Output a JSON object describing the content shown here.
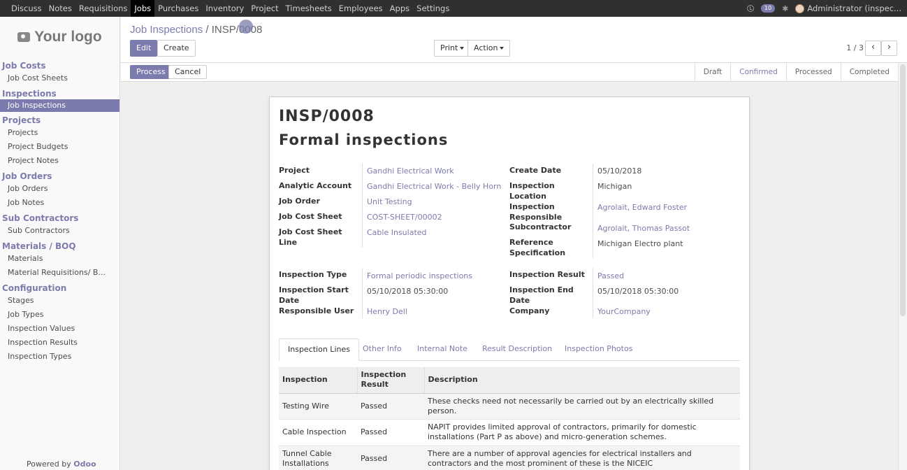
{
  "topmenu": [
    "Discuss",
    "Notes",
    "Requisitions",
    "Jobs",
    "Purchases",
    "Inventory",
    "Project",
    "Timesheets",
    "Employees",
    "Apps",
    "Settings"
  ],
  "topmenu_active": "Jobs",
  "user": {
    "messages_count": "10",
    "name": "Administrator (inspec..."
  },
  "logo": {
    "text": "Your logo"
  },
  "sidebar": {
    "sections": [
      {
        "title": "Job Costs",
        "items": [
          "Job Cost Sheets"
        ]
      },
      {
        "title": "Inspections",
        "items": [
          "Job Inspections"
        ]
      },
      {
        "title": "Projects",
        "items": [
          "Projects",
          "Project Budgets",
          "Project Notes"
        ]
      },
      {
        "title": "Job Orders",
        "items": [
          "Job Orders",
          "Job Notes"
        ]
      },
      {
        "title": "Sub Contractors",
        "items": [
          "Sub Contractors"
        ]
      },
      {
        "title": "Materials / BOQ",
        "items": [
          "Materials",
          "Material Requisitions/ B..."
        ]
      },
      {
        "title": "Configuration",
        "items": [
          "Stages",
          "Job Types",
          "Inspection Values",
          "Inspection Results",
          "Inspection Types"
        ]
      }
    ],
    "active_item": "Job Inspections",
    "powered_by": "Powered by",
    "powered_brand": "Odoo"
  },
  "breadcrumb": {
    "parent": "Job Inspections",
    "separator": "/",
    "current": "INSP/0008"
  },
  "buttons": {
    "edit": "Edit",
    "create": "Create",
    "print": "Print",
    "action": "Action",
    "process": "Process",
    "cancel": "Cancel"
  },
  "pager": {
    "text": "1 / 3"
  },
  "stages": [
    "Draft",
    "Confirmed",
    "Processed",
    "Completed"
  ],
  "active_stage": "Confirmed",
  "record": {
    "name": "INSP/0008",
    "title": "Formal inspections",
    "fields_left": [
      {
        "label": "Project",
        "value": "Gandhi Electrical Work",
        "link": true
      },
      {
        "label": "Analytic Account",
        "value": "Gandhi Electrical Work - Belly Horn",
        "link": true
      },
      {
        "label": "Job Order",
        "value": "Unit Testing",
        "link": true
      },
      {
        "label": "Job Cost Sheet",
        "value": "COST-SHEET/00002",
        "link": true
      },
      {
        "label": "Job Cost Sheet Line",
        "value": "Cable Insulated",
        "link": true
      }
    ],
    "fields_right": [
      {
        "label": "Create Date",
        "value": "05/10/2018",
        "link": false
      },
      {
        "label": "Inspection Location",
        "value": "Michigan",
        "link": false
      },
      {
        "label": "Inspection Responsible",
        "value": "Agrolait, Edward Foster",
        "link": true
      },
      {
        "label": "Subcontractor",
        "value": "Agrolait, Thomas Passot",
        "link": true
      },
      {
        "label": "Reference Specification",
        "value": "Michigan Electro plant",
        "link": false
      }
    ],
    "fields_left2": [
      {
        "label": "Inspection Type",
        "value": "Formal periodic inspections",
        "link": true
      },
      {
        "label": "Inspection Start Date",
        "value": "05/10/2018 05:30:00",
        "link": false
      },
      {
        "label": "Responsible User",
        "value": "Henry Dell",
        "link": true
      }
    ],
    "fields_right2": [
      {
        "label": "Inspection Result",
        "value": "Passed",
        "link": true
      },
      {
        "label": "Inspection End Date",
        "value": "05/10/2018 05:30:00",
        "link": false
      },
      {
        "label": "Company",
        "value": "YourCompany",
        "link": true
      }
    ]
  },
  "tabs": [
    "Inspection Lines",
    "Other Info",
    "Internal Note",
    "Result Description",
    "Inspection Photos"
  ],
  "active_tab": "Inspection Lines",
  "lines": {
    "headers": [
      "Inspection",
      "Inspection Result",
      "Description"
    ],
    "rows": [
      [
        "Testing Wire",
        "Passed",
        "These checks need not necessarily be carried out by an electrically skilled person."
      ],
      [
        "Cable Inspection",
        "Passed",
        "NAPIT provides limited approval of contractors, primarily for domestic installations (Part P as above) and micro-generation schemes."
      ],
      [
        "Tunnel Cable Installations",
        "Passed",
        "There are a number of approval agencies for electrical installers and contractors and the most prominent of these is the NICEIC"
      ]
    ]
  },
  "colors": {
    "accent": "#7c7bad",
    "topbar": "#303030"
  }
}
